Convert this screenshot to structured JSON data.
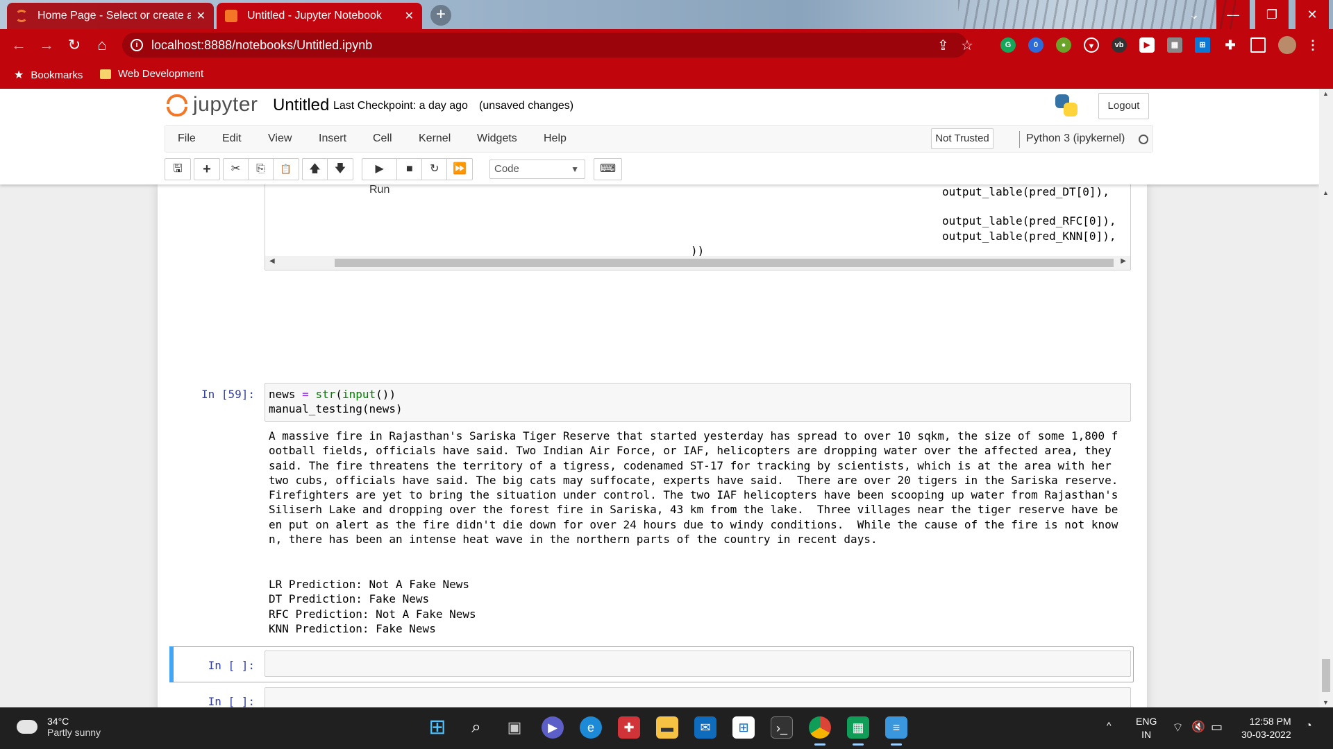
{
  "browser": {
    "tabs": [
      {
        "title": "Home Page - Select or create a n",
        "close": "✕"
      },
      {
        "title": "Untitled - Jupyter Notebook",
        "close": "✕"
      }
    ],
    "new_tab": "+",
    "window_controls": {
      "chevron": "⌄",
      "minimize": "—",
      "restore": "❐",
      "close": "✕"
    },
    "url": "localhost:8888/notebooks/Untitled.ipynb",
    "info_icon": "i",
    "ext_badge": "0",
    "bookmarks": [
      {
        "label": "Bookmarks",
        "icon": "star-icon"
      },
      {
        "label": "Web Development",
        "icon": "folder-icon"
      }
    ],
    "colors": {
      "chrome": "#c0050d",
      "omnibox": "#9a040a"
    }
  },
  "jupyter": {
    "logo_text": "jupyter",
    "notebook_name": "Untitled",
    "checkpoint": "Last Checkpoint: a day ago",
    "autosave": "(unsaved changes)",
    "logout": "Logout",
    "menu": [
      "File",
      "Edit",
      "View",
      "Insert",
      "Cell",
      "Kernel",
      "Widgets",
      "Help"
    ],
    "trusted": "Not Trusted",
    "kernel": "Python 3 (ipykernel)",
    "toolbar": {
      "save": "🖫",
      "insert": "+",
      "cut": "✂",
      "copy": "⎘",
      "paste": "📋",
      "up": "🡅",
      "down": "🡇",
      "run": "Run",
      "run_icon": "▶",
      "stop": "■",
      "restart": "↻",
      "run_all": "⏩",
      "cell_type": "Code",
      "cell_type_arrow": "▼",
      "keyboard": "⌨"
    },
    "colors": {
      "orange": "#f37726",
      "prompt": "#303f9f",
      "selected": "#42a5f5"
    }
  },
  "cells": {
    "prev_cell_tail": [
      "output_lable(pred_DT[0]),",
      "",
      "output_lable(pred_RFC[0]),",
      "output_lable(pred_KNN[0]),",
      "))"
    ],
    "scroll_left": "◀",
    "scroll_right": "▶",
    "cell59": {
      "prompt": "In [59]:",
      "code_line1": {
        "a": "news ",
        "b": "=",
        "c": " ",
        "d": "str",
        "e": "(",
        "f": "input",
        "g": "())"
      },
      "code_line2": "manual_testing(news)",
      "output_text": "A massive fire in Rajasthan's Sariska Tiger Reserve that started yesterday has spread to over 10 sqkm, the size of some 1,800 f\nootball fields, officials have said. Two Indian Air Force, or IAF, helicopters are dropping water over the affected area, they\nsaid. The fire threatens the territory of a tigress, codenamed ST-17 for tracking by scientists, which is at the area with her\ntwo cubs, officials have said. The big cats may suffocate, experts have said.  There are over 20 tigers in the Sariska reserve.\nFirefighters are yet to bring the situation under control. The two IAF helicopters have been scooping up water from Rajasthan's\nSiliserh Lake and dropping over the forest fire in Sariska, 43 km from the lake.  Three villages near the tiger reserve have be\nen put on alert as the fire didn't die down for over 24 hours due to windy conditions.  While the cause of the fire is not know\nn, there has been an intense heat wave in the northern parts of the country in recent days.",
      "predictions": [
        "LR Prediction: Not A Fake News",
        "DT Prediction: Fake News",
        "RFC Prediction: Not A Fake News",
        "KNN Prediction: Fake News"
      ]
    },
    "empty_prompt_1": "In [ ]:",
    "empty_prompt_2": "In [ ]:"
  },
  "taskbar": {
    "weather_temp": "34°C",
    "weather_desc": "Partly sunny",
    "apps": [
      "windows-start",
      "search",
      "task-view",
      "teams-chat",
      "edge",
      "gift-app",
      "file-explorer",
      "mail",
      "microsoft-store",
      "terminal",
      "chrome",
      "sheets",
      "notepad"
    ],
    "tray_chevron": "^",
    "lang_line1": "ENG",
    "lang_line2": "IN",
    "wifi": "⌔",
    "volume": "🔇",
    "battery": "▭",
    "time": "12:58 PM",
    "date": "30-03-2022"
  }
}
